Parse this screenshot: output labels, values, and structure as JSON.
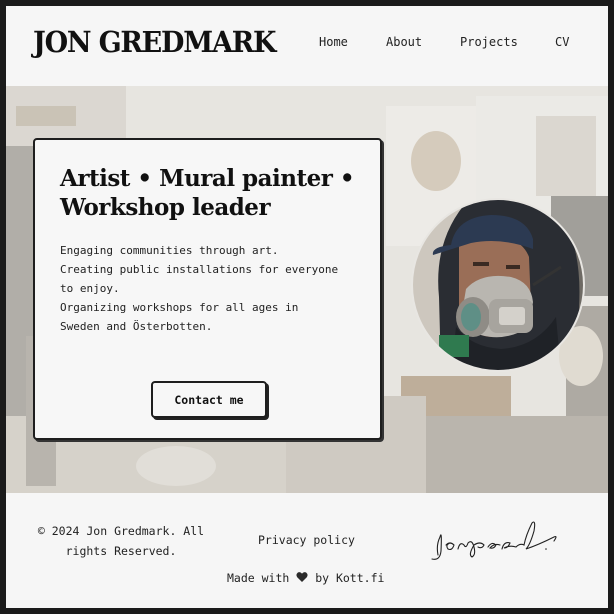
{
  "header": {
    "logo": "JON GREDMARK",
    "nav": [
      {
        "label": "Home"
      },
      {
        "label": "About"
      },
      {
        "label": "Projects"
      },
      {
        "label": "CV"
      }
    ]
  },
  "hero": {
    "title": "Artist • Mural painter • Workshop leader",
    "description_lines": [
      "Engaging communities through art.",
      "Creating public installations for everyone",
      "to enjoy.",
      "Organizing workshops for all ages in",
      "Sweden and Österbotten."
    ],
    "cta_label": "Contact me"
  },
  "footer": {
    "copyright": "© 2024 Jon Gredmark. All rights Reserved.",
    "privacy": "Privacy policy",
    "made_with_prefix": "Made with",
    "made_with_icon": "heart-icon",
    "made_with_suffix": "by Kott.fi"
  },
  "colors": {
    "page_bg": "#f6f6f6",
    "border": "#1e1e1e",
    "text": "#1a1a1a",
    "frame": "#1b1b1b"
  }
}
